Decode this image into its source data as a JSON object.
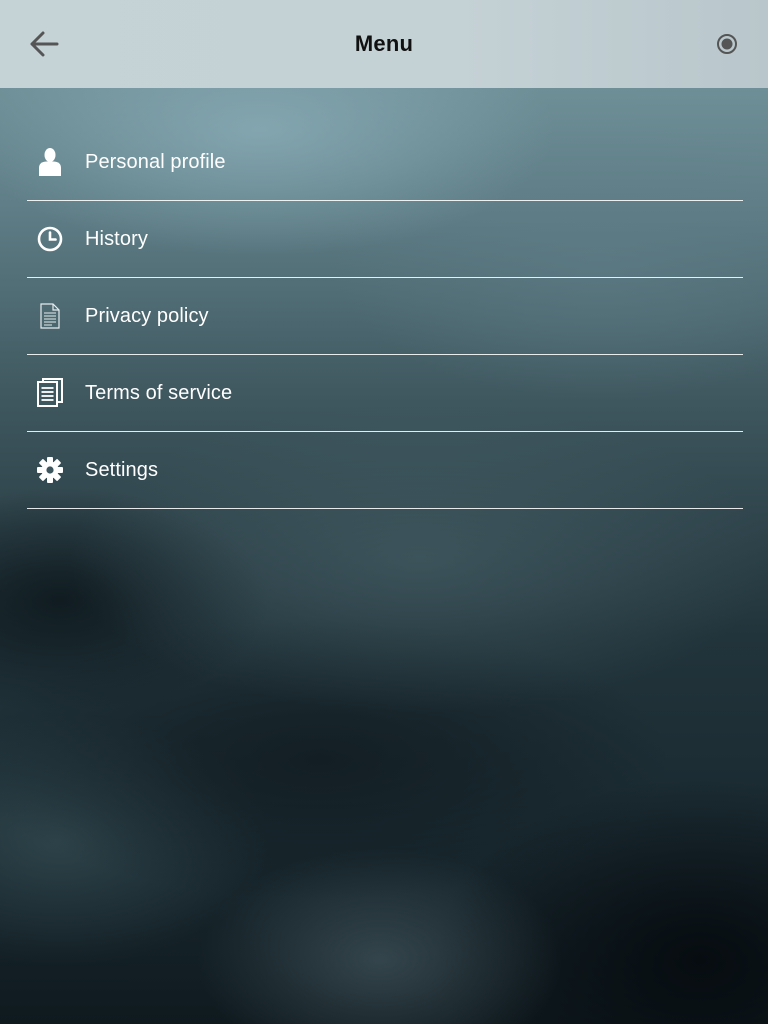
{
  "header": {
    "title": "Menu",
    "back_icon": "arrow-left-icon",
    "right_icon": "record-icon"
  },
  "menu": {
    "items": [
      {
        "label": "Personal profile",
        "icon": "person-icon"
      },
      {
        "label": "History",
        "icon": "clock-icon"
      },
      {
        "label": "Privacy policy",
        "icon": "document-icon"
      },
      {
        "label": "Terms of service",
        "icon": "documents-icon"
      },
      {
        "label": "Settings",
        "icon": "gear-icon"
      }
    ]
  },
  "colors": {
    "header_bg": "#c4d1d5",
    "text": "#ffffff",
    "title": "#111111"
  }
}
